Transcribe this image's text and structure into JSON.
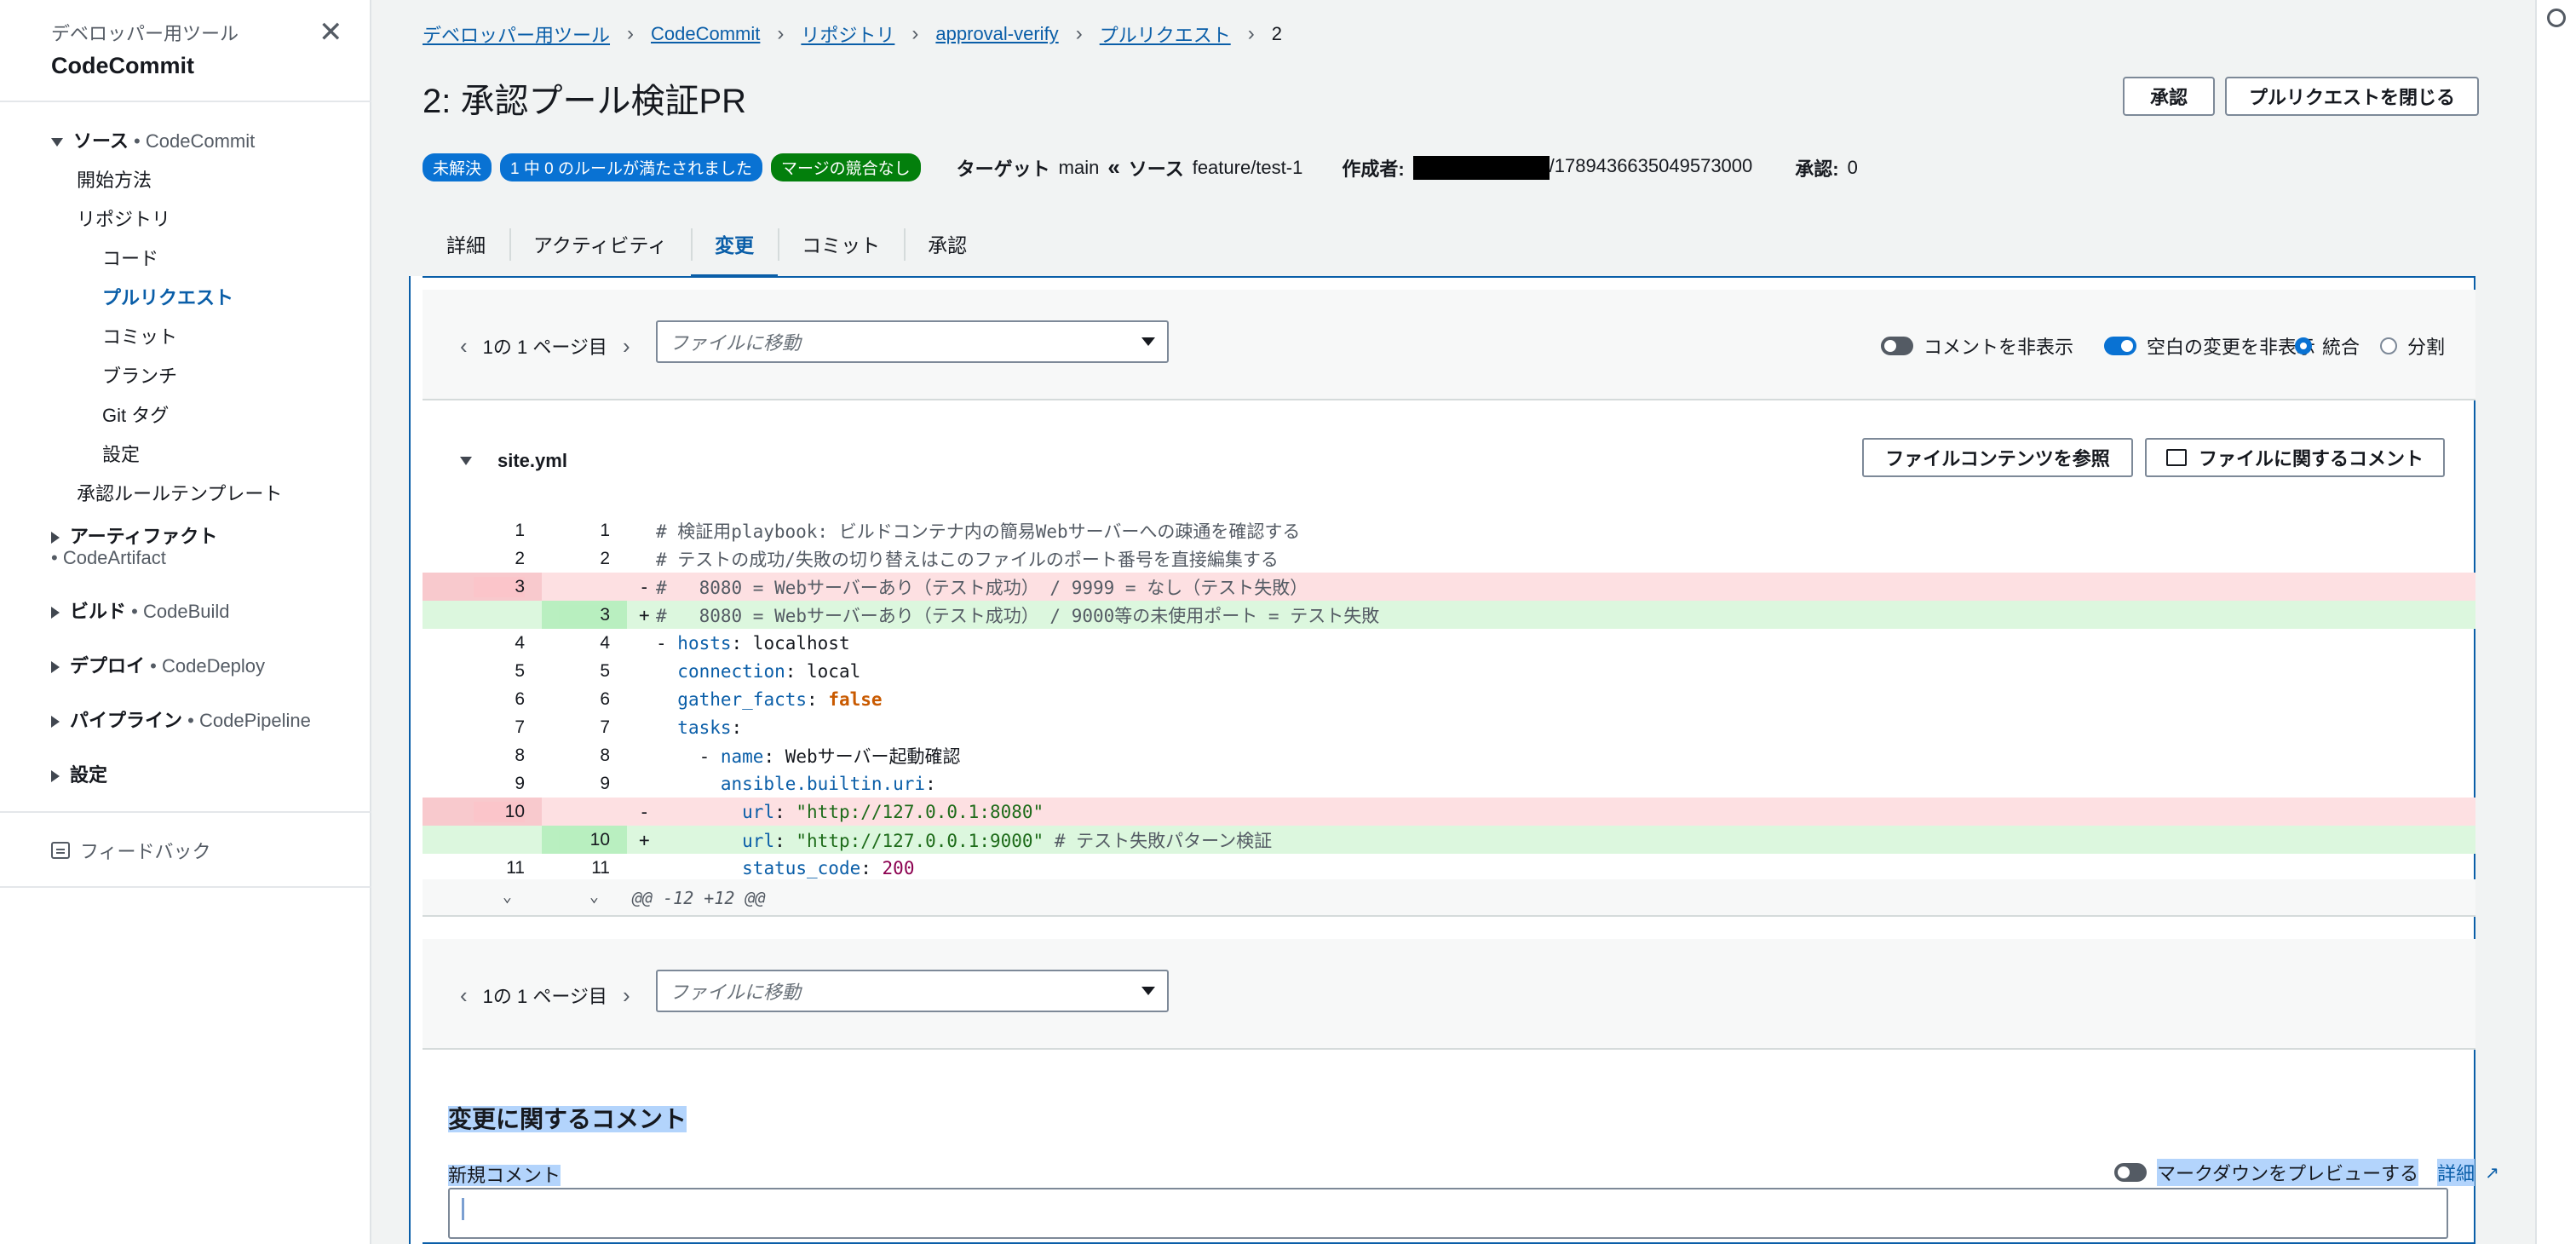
{
  "sidebar": {
    "subtitle": "デベロッパー用ツール",
    "title": "CodeCommit",
    "source_group": "ソース",
    "source_svc": "CodeCommit",
    "getting_started": "開始方法",
    "repositories": "リポジトリ",
    "code": "コード",
    "pull_requests": "プルリクエスト",
    "commits": "コミット",
    "branches": "ブランチ",
    "git_tags": "Git タグ",
    "settings_sub": "設定",
    "approval_templates": "承認ルールテンプレート",
    "artifacts": "アーティファクト",
    "artifacts_svc": "CodeArtifact",
    "build": "ビルド",
    "build_svc": "CodeBuild",
    "deploy": "デプロイ",
    "deploy_svc": "CodeDeploy",
    "pipeline": "パイプライン",
    "pipeline_svc": "CodePipeline",
    "settings": "設定",
    "feedback": "フィードバック"
  },
  "breadcrumb": [
    "デベロッパー用ツール",
    "CodeCommit",
    "リポジトリ",
    "approval-verify",
    "プルリクエスト",
    "2"
  ],
  "page": {
    "title": "2: 承認プール検証PR",
    "approve_button": "承認",
    "close_button": "プルリクエストを閉じる"
  },
  "meta": {
    "status": "未解決",
    "rules": "1 中 0 のルールが満たされました",
    "merge": "マージの競合なし",
    "target_label": "ターゲット",
    "target": "main",
    "source_label": "ソース",
    "source": "feature/test-1",
    "author_label": "作成者:",
    "author_suffix": "/1789436635049573000",
    "approvals_label": "承認:",
    "approvals": "0"
  },
  "tabs": [
    "詳細",
    "アクティビティ",
    "変更",
    "コミット",
    "承認"
  ],
  "toolbar": {
    "page_info": "1の 1 ページ目",
    "file_placeholder": "ファイルに移動",
    "hide_comments": "コメントを非表示",
    "hide_whitespace": "空白の変更を非表示",
    "unified": "統合",
    "split": "分割"
  },
  "file": {
    "name": "site.yml",
    "view_contents": "ファイルコンテンツを参照",
    "comment_on_file": "ファイルに関するコメント"
  },
  "diff": [
    {
      "type": "ctx",
      "l": "1",
      "r": "1",
      "sign": "",
      "code": "# 検証用playbook: ビルドコンテナ内の簡易Webサーバーへの疎通を確認する"
    },
    {
      "type": "ctx",
      "l": "2",
      "r": "2",
      "sign": "",
      "code": "# テストの成功/失敗の切り替えはこのファイルのポート番号を直接編集する"
    },
    {
      "type": "del",
      "l": "3",
      "r": "",
      "sign": "-",
      "code": "#   8080 = Webサーバーあり（テスト成功） / 9999 = なし（テスト失敗）"
    },
    {
      "type": "add",
      "l": "",
      "r": "3",
      "sign": "+",
      "code": "#   8080 = Webサーバーあり（テスト成功） / 9000等の未使用ポート = テスト失敗"
    },
    {
      "type": "ctx",
      "l": "4",
      "r": "4",
      "sign": "",
      "code": "- hosts: localhost"
    },
    {
      "type": "ctx",
      "l": "5",
      "r": "5",
      "sign": "",
      "code": "  connection: local"
    },
    {
      "type": "ctx",
      "l": "6",
      "r": "6",
      "sign": "",
      "code": "  gather_facts: false"
    },
    {
      "type": "ctx",
      "l": "7",
      "r": "7",
      "sign": "",
      "code": "  tasks:"
    },
    {
      "type": "ctx",
      "l": "8",
      "r": "8",
      "sign": "",
      "code": "    - name: Webサーバー起動確認"
    },
    {
      "type": "ctx",
      "l": "9",
      "r": "9",
      "sign": "",
      "code": "      ansible.builtin.uri:"
    },
    {
      "type": "del",
      "l": "10",
      "r": "",
      "sign": "-",
      "code": "        url: \"http://127.0.0.1:8080\""
    },
    {
      "type": "add",
      "l": "",
      "r": "10",
      "sign": "+",
      "code": "        url: \"http://127.0.0.1:9000\" # テスト失敗パターン検証"
    },
    {
      "type": "ctx",
      "l": "11",
      "r": "11",
      "sign": "",
      "code": "        status_code: 200"
    }
  ],
  "hunk_header": "@@ -12 +12 @@",
  "comments": {
    "heading": "変更に関するコメント",
    "new_comment": "新規コメント",
    "preview_markdown": "マークダウンをプレビューする",
    "info": "詳細"
  },
  "colors": {
    "link": "#0a5ea8",
    "badge_blue": "#0972d3",
    "badge_green": "#037f0c",
    "deleted_bg": "#fde0e2",
    "added_bg": "#dcf7de"
  }
}
